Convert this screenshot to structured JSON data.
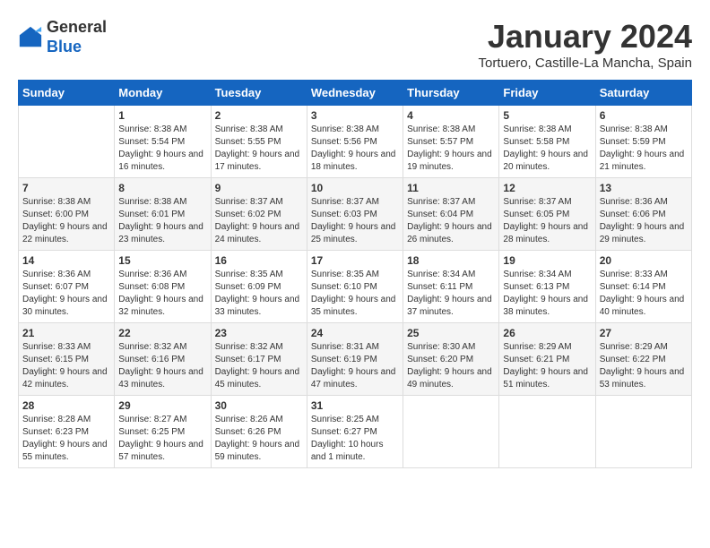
{
  "header": {
    "logo_general": "General",
    "logo_blue": "Blue",
    "title": "January 2024",
    "location": "Tortuero, Castille-La Mancha, Spain"
  },
  "columns": [
    "Sunday",
    "Monday",
    "Tuesday",
    "Wednesday",
    "Thursday",
    "Friday",
    "Saturday"
  ],
  "weeks": [
    [
      {
        "day": "",
        "sunrise": "",
        "sunset": "",
        "daylight": ""
      },
      {
        "day": "1",
        "sunrise": "Sunrise: 8:38 AM",
        "sunset": "Sunset: 5:54 PM",
        "daylight": "Daylight: 9 hours and 16 minutes."
      },
      {
        "day": "2",
        "sunrise": "Sunrise: 8:38 AM",
        "sunset": "Sunset: 5:55 PM",
        "daylight": "Daylight: 9 hours and 17 minutes."
      },
      {
        "day": "3",
        "sunrise": "Sunrise: 8:38 AM",
        "sunset": "Sunset: 5:56 PM",
        "daylight": "Daylight: 9 hours and 18 minutes."
      },
      {
        "day": "4",
        "sunrise": "Sunrise: 8:38 AM",
        "sunset": "Sunset: 5:57 PM",
        "daylight": "Daylight: 9 hours and 19 minutes."
      },
      {
        "day": "5",
        "sunrise": "Sunrise: 8:38 AM",
        "sunset": "Sunset: 5:58 PM",
        "daylight": "Daylight: 9 hours and 20 minutes."
      },
      {
        "day": "6",
        "sunrise": "Sunrise: 8:38 AM",
        "sunset": "Sunset: 5:59 PM",
        "daylight": "Daylight: 9 hours and 21 minutes."
      }
    ],
    [
      {
        "day": "7",
        "sunrise": "Sunrise: 8:38 AM",
        "sunset": "Sunset: 6:00 PM",
        "daylight": "Daylight: 9 hours and 22 minutes."
      },
      {
        "day": "8",
        "sunrise": "Sunrise: 8:38 AM",
        "sunset": "Sunset: 6:01 PM",
        "daylight": "Daylight: 9 hours and 23 minutes."
      },
      {
        "day": "9",
        "sunrise": "Sunrise: 8:37 AM",
        "sunset": "Sunset: 6:02 PM",
        "daylight": "Daylight: 9 hours and 24 minutes."
      },
      {
        "day": "10",
        "sunrise": "Sunrise: 8:37 AM",
        "sunset": "Sunset: 6:03 PM",
        "daylight": "Daylight: 9 hours and 25 minutes."
      },
      {
        "day": "11",
        "sunrise": "Sunrise: 8:37 AM",
        "sunset": "Sunset: 6:04 PM",
        "daylight": "Daylight: 9 hours and 26 minutes."
      },
      {
        "day": "12",
        "sunrise": "Sunrise: 8:37 AM",
        "sunset": "Sunset: 6:05 PM",
        "daylight": "Daylight: 9 hours and 28 minutes."
      },
      {
        "day": "13",
        "sunrise": "Sunrise: 8:36 AM",
        "sunset": "Sunset: 6:06 PM",
        "daylight": "Daylight: 9 hours and 29 minutes."
      }
    ],
    [
      {
        "day": "14",
        "sunrise": "Sunrise: 8:36 AM",
        "sunset": "Sunset: 6:07 PM",
        "daylight": "Daylight: 9 hours and 30 minutes."
      },
      {
        "day": "15",
        "sunrise": "Sunrise: 8:36 AM",
        "sunset": "Sunset: 6:08 PM",
        "daylight": "Daylight: 9 hours and 32 minutes."
      },
      {
        "day": "16",
        "sunrise": "Sunrise: 8:35 AM",
        "sunset": "Sunset: 6:09 PM",
        "daylight": "Daylight: 9 hours and 33 minutes."
      },
      {
        "day": "17",
        "sunrise": "Sunrise: 8:35 AM",
        "sunset": "Sunset: 6:10 PM",
        "daylight": "Daylight: 9 hours and 35 minutes."
      },
      {
        "day": "18",
        "sunrise": "Sunrise: 8:34 AM",
        "sunset": "Sunset: 6:11 PM",
        "daylight": "Daylight: 9 hours and 37 minutes."
      },
      {
        "day": "19",
        "sunrise": "Sunrise: 8:34 AM",
        "sunset": "Sunset: 6:13 PM",
        "daylight": "Daylight: 9 hours and 38 minutes."
      },
      {
        "day": "20",
        "sunrise": "Sunrise: 8:33 AM",
        "sunset": "Sunset: 6:14 PM",
        "daylight": "Daylight: 9 hours and 40 minutes."
      }
    ],
    [
      {
        "day": "21",
        "sunrise": "Sunrise: 8:33 AM",
        "sunset": "Sunset: 6:15 PM",
        "daylight": "Daylight: 9 hours and 42 minutes."
      },
      {
        "day": "22",
        "sunrise": "Sunrise: 8:32 AM",
        "sunset": "Sunset: 6:16 PM",
        "daylight": "Daylight: 9 hours and 43 minutes."
      },
      {
        "day": "23",
        "sunrise": "Sunrise: 8:32 AM",
        "sunset": "Sunset: 6:17 PM",
        "daylight": "Daylight: 9 hours and 45 minutes."
      },
      {
        "day": "24",
        "sunrise": "Sunrise: 8:31 AM",
        "sunset": "Sunset: 6:19 PM",
        "daylight": "Daylight: 9 hours and 47 minutes."
      },
      {
        "day": "25",
        "sunrise": "Sunrise: 8:30 AM",
        "sunset": "Sunset: 6:20 PM",
        "daylight": "Daylight: 9 hours and 49 minutes."
      },
      {
        "day": "26",
        "sunrise": "Sunrise: 8:29 AM",
        "sunset": "Sunset: 6:21 PM",
        "daylight": "Daylight: 9 hours and 51 minutes."
      },
      {
        "day": "27",
        "sunrise": "Sunrise: 8:29 AM",
        "sunset": "Sunset: 6:22 PM",
        "daylight": "Daylight: 9 hours and 53 minutes."
      }
    ],
    [
      {
        "day": "28",
        "sunrise": "Sunrise: 8:28 AM",
        "sunset": "Sunset: 6:23 PM",
        "daylight": "Daylight: 9 hours and 55 minutes."
      },
      {
        "day": "29",
        "sunrise": "Sunrise: 8:27 AM",
        "sunset": "Sunset: 6:25 PM",
        "daylight": "Daylight: 9 hours and 57 minutes."
      },
      {
        "day": "30",
        "sunrise": "Sunrise: 8:26 AM",
        "sunset": "Sunset: 6:26 PM",
        "daylight": "Daylight: 9 hours and 59 minutes."
      },
      {
        "day": "31",
        "sunrise": "Sunrise: 8:25 AM",
        "sunset": "Sunset: 6:27 PM",
        "daylight": "Daylight: 10 hours and 1 minute."
      },
      {
        "day": "",
        "sunrise": "",
        "sunset": "",
        "daylight": ""
      },
      {
        "day": "",
        "sunrise": "",
        "sunset": "",
        "daylight": ""
      },
      {
        "day": "",
        "sunrise": "",
        "sunset": "",
        "daylight": ""
      }
    ]
  ]
}
